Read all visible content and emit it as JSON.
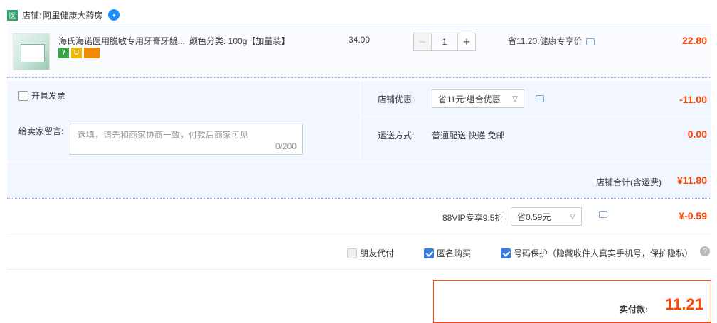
{
  "shop": {
    "logo_text": "医",
    "label": "店铺:",
    "name": "阿里健康大药房"
  },
  "item": {
    "title": "海氏海诺医用脱敏专用牙膏牙龈...",
    "sku": "颜色分类: 100g【加量装】",
    "price": "34.00",
    "quantity": "1",
    "minus": "−",
    "plus": "+",
    "discount": "省11.20:健康专享价",
    "total": "22.80",
    "badges": [
      "7",
      "U",
      ""
    ]
  },
  "invoice": {
    "label": "开具发票"
  },
  "memo": {
    "label": "给卖家留言:",
    "placeholder": "选填，请先和商家协商一致，付款后商家可见",
    "count": "0/200"
  },
  "shop_discount": {
    "label": "店铺优惠:",
    "selected": "省11元:组合优惠",
    "amount": "-11.00"
  },
  "shipping": {
    "label": "运送方式:",
    "value": "普通配送 快递 免邮",
    "amount": "0.00"
  },
  "subtotal": {
    "label": "店铺合计(含运费)",
    "value": "¥11.80"
  },
  "vip": {
    "label": "88VIP专享9.5折",
    "selected": "省0.59元",
    "amount": "¥-0.59"
  },
  "flags": {
    "friend_pay": "朋友代付",
    "anonymous": "匿名购买",
    "number_protect": "号码保护（隐藏收件人真实手机号，保护隐私）",
    "help": "?"
  },
  "pay": {
    "label": "实付款:",
    "value": "11.21"
  },
  "colors": {
    "accent": "#ff4400",
    "panel": "#f2f7ff",
    "border": "#b2d1ff"
  }
}
